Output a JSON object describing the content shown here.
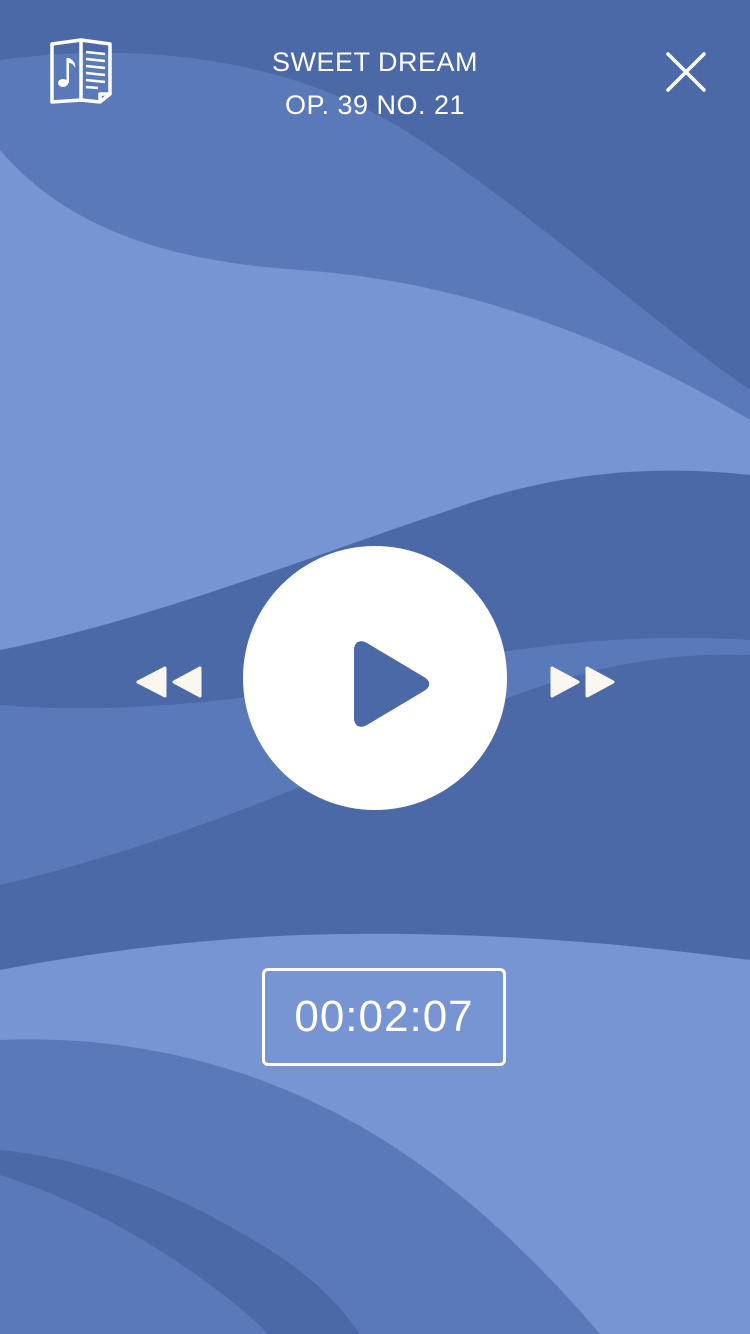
{
  "track": {
    "title": "SWEET DREAM",
    "subtitle": "OP. 39 NO. 21"
  },
  "timer": {
    "elapsed": "00:02:07"
  },
  "icons": {
    "sheet_music": "sheet-music-book-icon",
    "close": "close-icon",
    "play": "play-icon",
    "rewind": "rewind-icon",
    "fast_forward": "fast-forward-icon"
  },
  "colors": {
    "background_dark": "#4a69a6",
    "background_mid": "#5979b8",
    "background_light": "#7795d2",
    "foreground": "#ffffff"
  }
}
